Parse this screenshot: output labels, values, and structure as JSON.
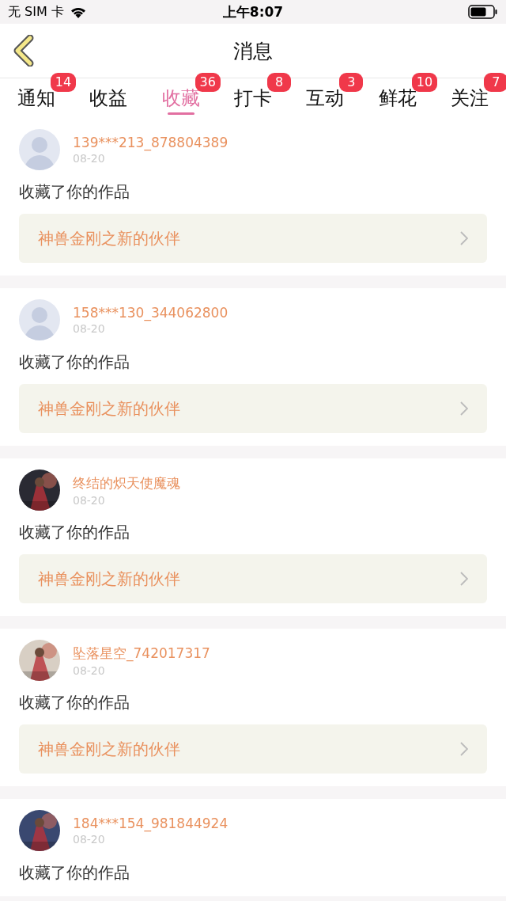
{
  "status_bar": {
    "carrier": "无 SIM 卡",
    "time": "上午8:07"
  },
  "header": {
    "title": "消息"
  },
  "tabs": [
    {
      "label": "通知",
      "badge": "14",
      "selected": false
    },
    {
      "label": "收益",
      "selected": false
    },
    {
      "label": "收藏",
      "badge": "36",
      "selected": true
    },
    {
      "label": "打卡",
      "badge": "8",
      "selected": false
    },
    {
      "label": "互动",
      "badge": "3",
      "selected": false
    },
    {
      "label": "鲜花",
      "badge": "10",
      "selected": false
    },
    {
      "label": "关注",
      "badge": "7",
      "selected": false
    }
  ],
  "messages": [
    {
      "avatar": {
        "kind": "default"
      },
      "user": "139***213_878804389",
      "date": "08-20",
      "text": "收藏了你的作品",
      "work": "神兽金刚之新的伙伴"
    },
    {
      "avatar": {
        "kind": "default"
      },
      "user": "158***130_344062800",
      "date": "08-20",
      "text": "收藏了你的作品",
      "work": "神兽金刚之新的伙伴"
    },
    {
      "user": "终结的炽天使魔魂",
      "date": "08-20",
      "text": "收藏了你的作品",
      "work": "神兽金刚之新的伙伴"
    },
    {
      "user": "坠落星空_742017317",
      "date": "08-20",
      "text": "收藏了你的作品",
      "work": "神兽金刚之新的伙伴"
    },
    {
      "user": "184***154_981844924",
      "date": "08-20",
      "text": "收藏了你的作品"
    }
  ]
}
